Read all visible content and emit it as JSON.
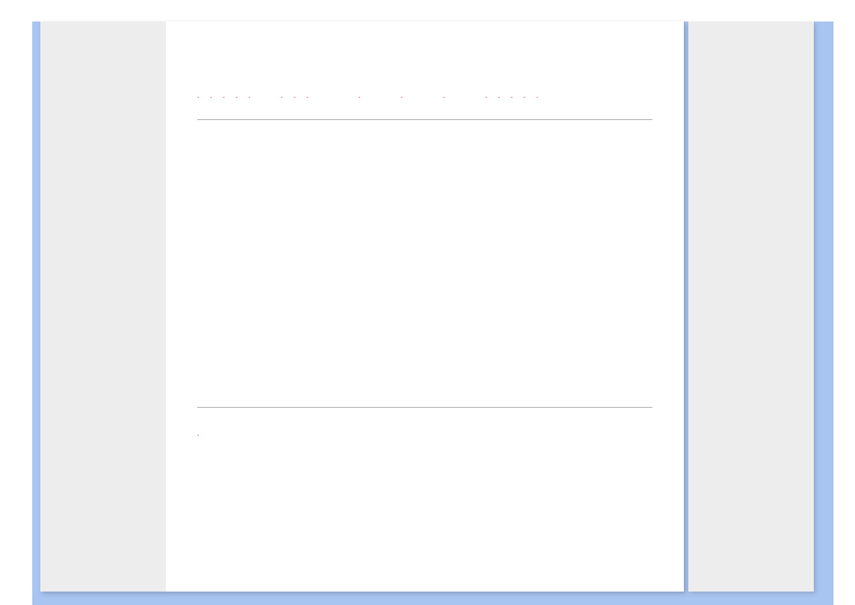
{
  "document": {
    "heading_text": "- - - - -   - - -     -    -    -    - - - - -",
    "footer_text": "-"
  }
}
